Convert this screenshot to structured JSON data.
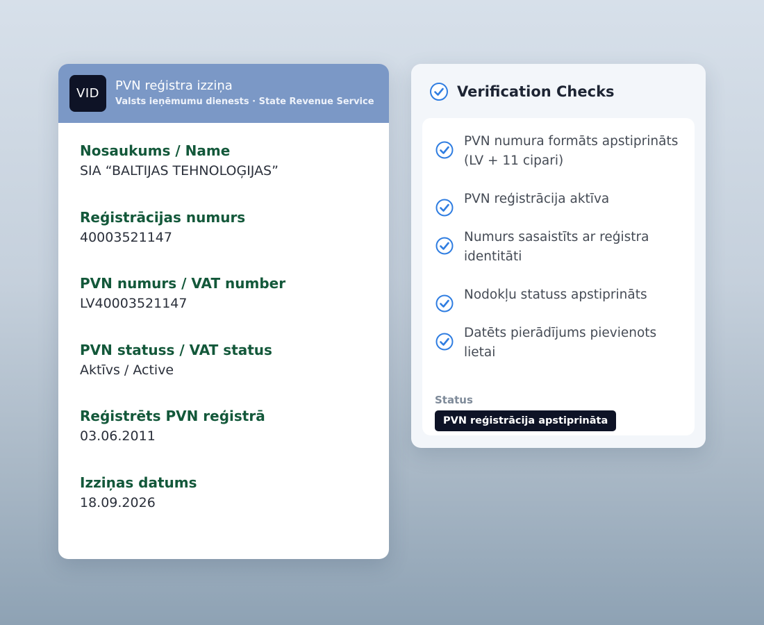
{
  "certificate": {
    "logo_text": "VID",
    "title": "PVN reģistra izziņa",
    "subtitle": "Valsts ieņēmumu dienests · State Revenue Service",
    "fields": [
      {
        "label": "Nosaukums / Name",
        "value": "SIA “BALTIJAS TEHNOLOĢIJAS”"
      },
      {
        "label": "Reģistrācijas numurs",
        "value": "40003521147"
      },
      {
        "label": "PVN numurs / VAT number",
        "value": "LV40003521147"
      },
      {
        "label": "PVN statuss / VAT status",
        "value": "Aktīvs / Active"
      },
      {
        "label": "Reģistrēts PVN reģistrā",
        "value": "03.06.2011"
      },
      {
        "label": "Izziņas datums",
        "value": "18.09.2026"
      }
    ]
  },
  "verification": {
    "title": "Verification Checks",
    "checks": [
      {
        "text": "PVN numura formāts apstiprināts (LV + 11 cipari)"
      },
      {
        "text": "PVN reģistrācija aktīva"
      },
      {
        "text": "Numurs sasaistīts ar reģistra identitāti"
      },
      {
        "text": "Nodokļu statuss apstiprināts"
      },
      {
        "text": "Datēts pierādījums pievienots lietai"
      }
    ],
    "status_label": "Status",
    "status_value": "PVN reģistrācija apstiprināta"
  },
  "colors": {
    "header_bg": "#7b98c6",
    "logo_bg": "#0e1326",
    "field_label": "#13583a",
    "check_blue": "#2f7de1",
    "badge_bg": "#0e1326"
  },
  "icons": {
    "check": "check-circle-icon"
  }
}
